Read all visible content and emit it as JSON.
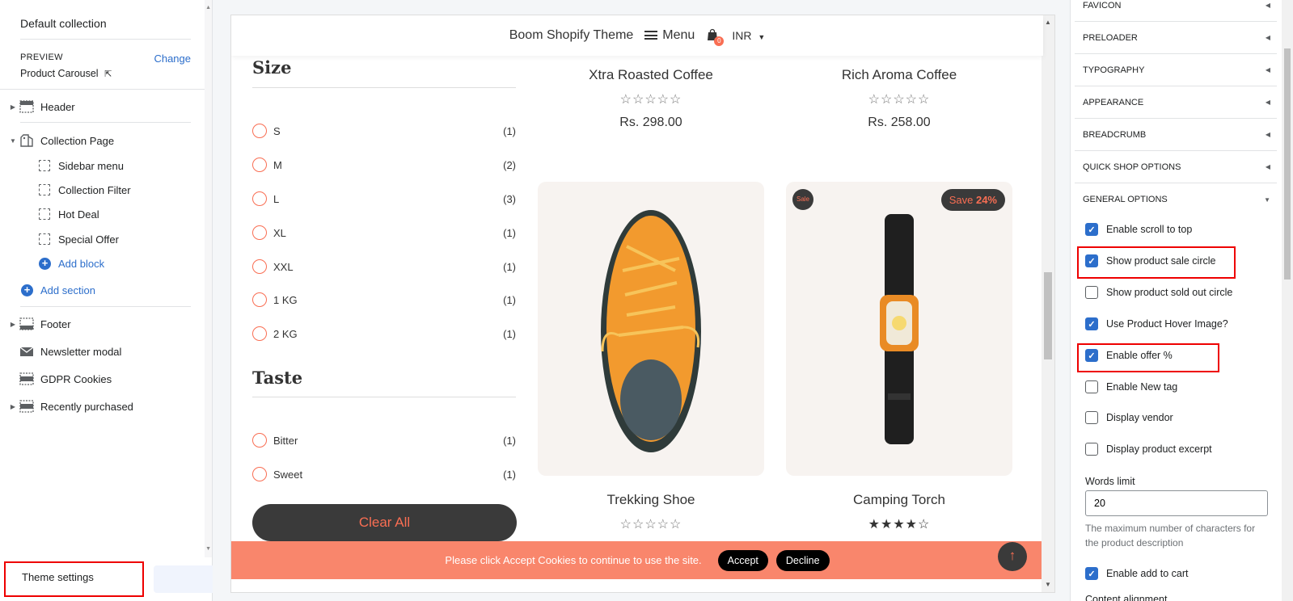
{
  "sidebar": {
    "collection_title": "Default collection",
    "preview_label": "PREVIEW",
    "change_label": "Change",
    "preview_value": "Product Carousel",
    "sections": {
      "header": "Header",
      "collection_page": "Collection Page",
      "blocks": [
        "Sidebar menu",
        "Collection Filter",
        "Hot Deal",
        "Special Offer"
      ],
      "add_block": "Add block",
      "add_section": "Add section",
      "footer": "Footer",
      "newsletter": "Newsletter modal",
      "gdpr": "GDPR Cookies",
      "recently": "Recently purchased"
    },
    "theme_settings": "Theme settings"
  },
  "store": {
    "brand": "Boom Shopify Theme",
    "menu": "Menu",
    "cart_count": "0",
    "currency": "INR"
  },
  "filters": {
    "size_title": "Size",
    "size_options": [
      {
        "label": "S",
        "count": "(1)"
      },
      {
        "label": "M",
        "count": "(2)"
      },
      {
        "label": "L",
        "count": "(3)"
      },
      {
        "label": "XL",
        "count": "(1)"
      },
      {
        "label": "XXL",
        "count": "(1)"
      },
      {
        "label": "1 KG",
        "count": "(1)"
      },
      {
        "label": "2 KG",
        "count": "(1)"
      }
    ],
    "taste_title": "Taste",
    "taste_options": [
      {
        "label": "Bitter",
        "count": "(1)"
      },
      {
        "label": "Sweet",
        "count": "(1)"
      }
    ],
    "clear_all": "Clear All"
  },
  "products": {
    "p1": {
      "name": "Xtra Roasted Coffee",
      "stars": "☆☆☆☆☆",
      "price": "Rs. 298.00"
    },
    "p2": {
      "name": "Rich Aroma Coffee",
      "stars": "☆☆☆☆☆",
      "price": "Rs. 258.00"
    },
    "p3": {
      "name": "Trekking Shoe",
      "stars": "☆☆☆☆☆",
      "rating": 0
    },
    "p4": {
      "name": "Camping Torch",
      "stars": "★★★★☆",
      "rating": 4,
      "sale_badge": "Sale",
      "save_label": "Save",
      "save_pct": "24%"
    }
  },
  "cookie": {
    "message": "Please click Accept Cookies to continue to use the site.",
    "accept": "Accept",
    "decline": "Decline"
  },
  "settings": {
    "accordions": [
      "FAVICON",
      "PRELOADER",
      "TYPOGRAPHY",
      "APPEARANCE",
      "BREADCRUMB",
      "QUICK SHOP OPTIONS",
      "GENERAL OPTIONS"
    ],
    "options": [
      {
        "label": "Enable scroll to top",
        "checked": true
      },
      {
        "label": "Show product sale circle",
        "checked": true
      },
      {
        "label": "Show product sold out circle",
        "checked": false
      },
      {
        "label": "Use Product Hover Image?",
        "checked": true
      },
      {
        "label": "Enable offer %",
        "checked": true
      },
      {
        "label": "Enable New tag",
        "checked": false
      },
      {
        "label": "Display vendor",
        "checked": false
      },
      {
        "label": "Display product excerpt",
        "checked": false
      }
    ],
    "words_limit_label": "Words limit",
    "words_limit_value": "20",
    "words_help": "The maximum number of characters for the product description",
    "add_to_cart": {
      "label": "Enable add to cart",
      "checked": true
    },
    "content_alignment": "Content alignment"
  },
  "colors": {
    "accent": "#f96e53",
    "link": "#2c6ecb",
    "highlight": "#ee0000"
  }
}
